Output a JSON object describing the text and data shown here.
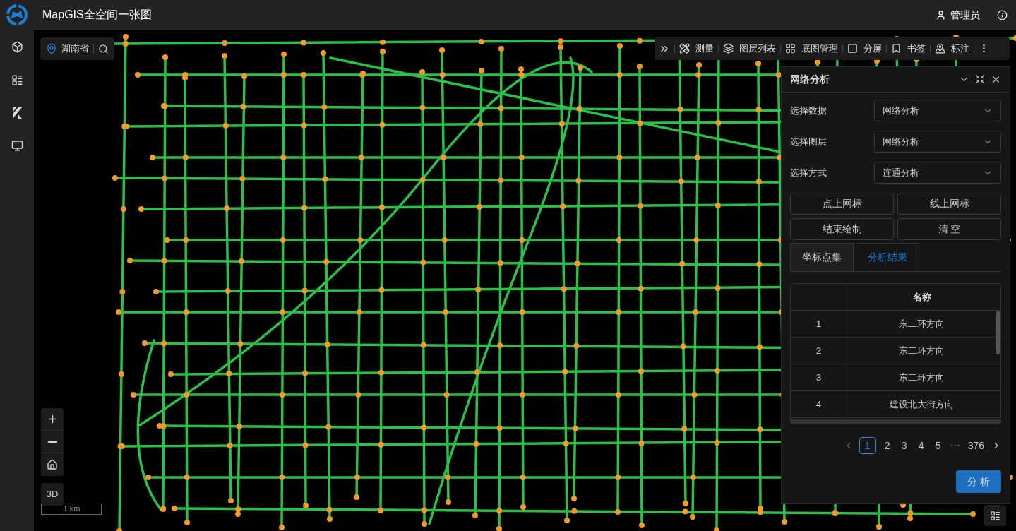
{
  "header": {
    "title": "MapGIS全空间一张图",
    "user": "管理员"
  },
  "location": {
    "region": "湖南省"
  },
  "toolbar": {
    "items": [
      {
        "label": "测量"
      },
      {
        "label": "图层列表"
      },
      {
        "label": "底图管理"
      },
      {
        "label": "分屏"
      },
      {
        "label": "书签"
      },
      {
        "label": "标注"
      }
    ]
  },
  "panel": {
    "title": "网络分析",
    "fields": [
      {
        "label": "选择数据",
        "value": "网络分析"
      },
      {
        "label": "选择图层",
        "value": "网络分析"
      },
      {
        "label": "选择方式",
        "value": "连通分析"
      }
    ],
    "buttons": [
      "点上网标",
      "线上网标",
      "结束绘制",
      "清 空"
    ],
    "tabs": [
      {
        "label": "坐标点集",
        "selected": false
      },
      {
        "label": "分析结果",
        "selected": true
      }
    ],
    "table": {
      "columns": [
        "名称"
      ],
      "rows": [
        {
          "index": "1",
          "name": "东二环方向"
        },
        {
          "index": "2",
          "name": "东二环方向"
        },
        {
          "index": "3",
          "name": "东二环方向"
        },
        {
          "index": "4",
          "name": "建设北大街方向"
        }
      ]
    },
    "pagination": {
      "pages": [
        {
          "label": "1",
          "selected": true
        },
        {
          "label": "2",
          "selected": false
        },
        {
          "label": "3",
          "selected": false
        },
        {
          "label": "4",
          "selected": false
        },
        {
          "label": "5",
          "selected": false
        }
      ],
      "last": "376"
    },
    "submit": "分 析"
  },
  "map_controls": {
    "mode": "3D",
    "scale": "1 km"
  }
}
